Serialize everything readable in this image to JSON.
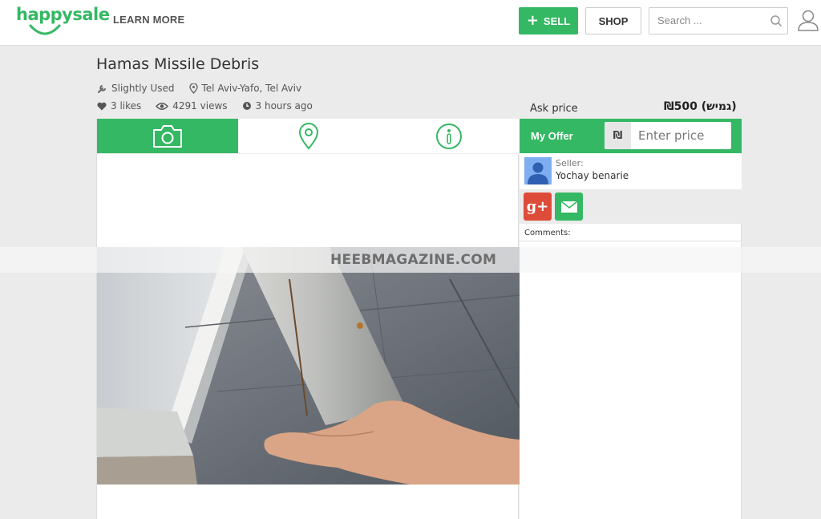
{
  "header": {
    "logo_text": "happysale",
    "learn_more": "LEARN MORE",
    "sell_label": "SELL",
    "shop_label": "SHOP",
    "search_placeholder": "Search ...",
    "brand_color": "#35b864"
  },
  "listing": {
    "title": "Hamas Missile Debris",
    "condition": "Slightly Used",
    "location": "Tel Aviv-Yafo, Tel Aviv",
    "likes": "3 likes",
    "views": "4291 views",
    "posted": "3 hours ago",
    "ask_label": "Ask price",
    "ask_price": "₪500 (גמיש)",
    "tabs": [
      {
        "icon": "camera-icon",
        "active": true
      },
      {
        "icon": "map-pin-icon",
        "active": false
      },
      {
        "icon": "info-icon",
        "active": false
      }
    ]
  },
  "offer": {
    "label": "My Offer",
    "currency_symbol": "₪",
    "placeholder": "Enter price"
  },
  "seller": {
    "label": "Seller:",
    "name": "Yochay benarie"
  },
  "share": {
    "gplus_label": "g+"
  },
  "comments": {
    "label": "Comments:"
  },
  "watermark": "HEEBMAGAZINE.COM"
}
